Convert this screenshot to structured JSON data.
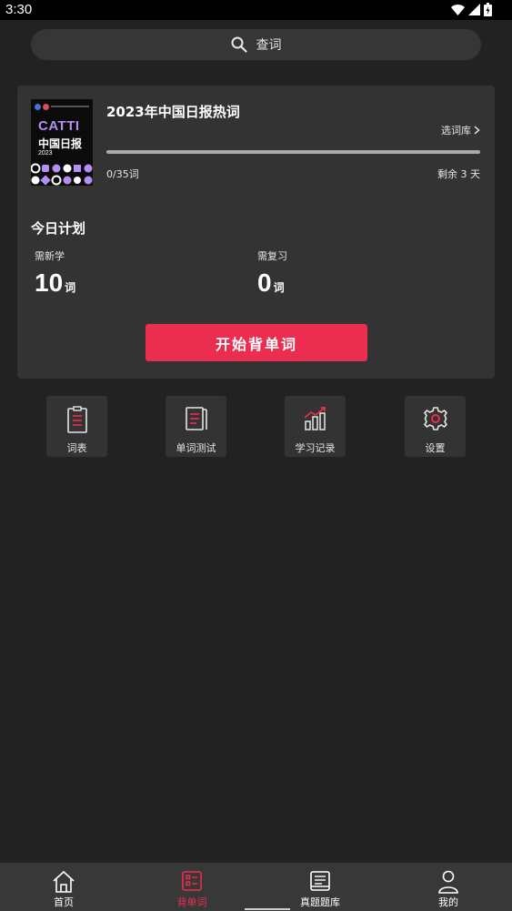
{
  "status_bar": {
    "time": "3:30"
  },
  "search": {
    "label": "查词"
  },
  "book": {
    "title": "2023年中国日报热词",
    "choose_label": "选词库",
    "progress_text": "0/35词",
    "progress_fraction": 0,
    "remaining": "剩余 3 天",
    "cover": {
      "brand": "CATTI",
      "subtitle": "中国日报",
      "year": "2023"
    }
  },
  "plan": {
    "title": "今日计划",
    "new": {
      "label": "需新学",
      "value": "10",
      "unit": "词"
    },
    "review": {
      "label": "需复习",
      "value": "0",
      "unit": "词"
    }
  },
  "start_button": {
    "label": "开始背单词"
  },
  "tools": [
    {
      "label": "词表",
      "icon": "clipboard-list-icon"
    },
    {
      "label": "单词测试",
      "icon": "notebook-test-icon"
    },
    {
      "label": "学习记录",
      "icon": "bar-chart-trend-icon"
    },
    {
      "label": "设置",
      "icon": "gear-icon"
    }
  ],
  "nav": [
    {
      "label": "首页",
      "icon": "home-icon",
      "active": false
    },
    {
      "label": "背单词",
      "icon": "flashcard-icon",
      "active": true
    },
    {
      "label": "真题题库",
      "icon": "question-bank-icon",
      "active": false
    },
    {
      "label": "我的",
      "icon": "profile-icon",
      "active": false
    }
  ],
  "colors": {
    "accent": "#eb2d4f",
    "background": "#222222",
    "card": "#333333",
    "cover_purple": "#b68cf5"
  }
}
